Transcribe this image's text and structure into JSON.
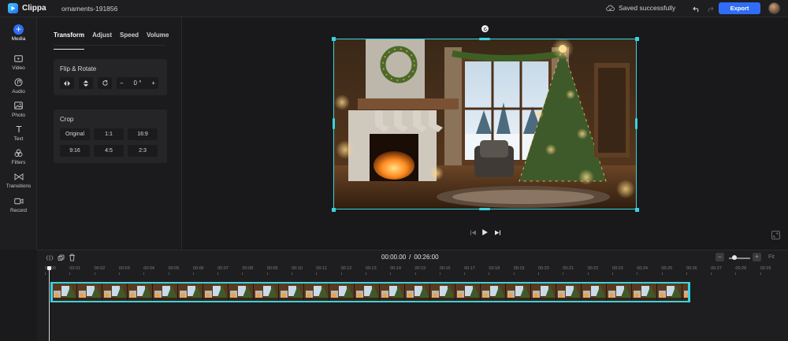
{
  "app": {
    "name": "Clippa",
    "project_name": "ornaments-191856",
    "save_status": "Saved successfully",
    "export_label": "Export",
    "accent_color": "#2f6df6",
    "selection_color": "#39d3e0"
  },
  "sidebar": {
    "items": [
      {
        "label": "Media",
        "icon": "plus-circle-icon"
      },
      {
        "label": "Video",
        "icon": "video-icon"
      },
      {
        "label": "Audio",
        "icon": "audio-icon"
      },
      {
        "label": "Photo",
        "icon": "photo-icon"
      },
      {
        "label": "Text",
        "icon": "text-icon"
      },
      {
        "label": "Filters",
        "icon": "filters-icon"
      },
      {
        "label": "Transitions",
        "icon": "transitions-icon"
      },
      {
        "label": "Record",
        "icon": "record-icon"
      }
    ]
  },
  "panel": {
    "tabs": [
      "Transform",
      "Adjust",
      "Speed",
      "Volume"
    ],
    "active_tab": "Transform",
    "flip_rotate": {
      "title": "Flip & Rotate",
      "rotation_value": "0",
      "rotation_unit": "°",
      "minus": "−",
      "plus": "+"
    },
    "crop": {
      "title": "Crop",
      "options": [
        "Original",
        "1:1",
        "16:9",
        "9:16",
        "4:5",
        "2:3"
      ]
    }
  },
  "timeline": {
    "current_time": "00:00.00",
    "separator": "/",
    "total_time": "00:26:00",
    "fit_label": "Fit",
    "zoom_level": 0.2,
    "ruler_labels": [
      "00:00",
      "00:01",
      "00:02",
      "00:03",
      "00:04",
      "00:05",
      "00:06",
      "00:07",
      "00:08",
      "00:09",
      "00:10",
      "00:11",
      "00:12",
      "00:13",
      "00:14",
      "00:15",
      "00:16",
      "00:17",
      "00:18",
      "00:19",
      "00:20",
      "00:21",
      "00:22",
      "00:23",
      "00:24",
      "00:25",
      "00:26",
      "00:27",
      "00:28",
      "00:29"
    ]
  }
}
